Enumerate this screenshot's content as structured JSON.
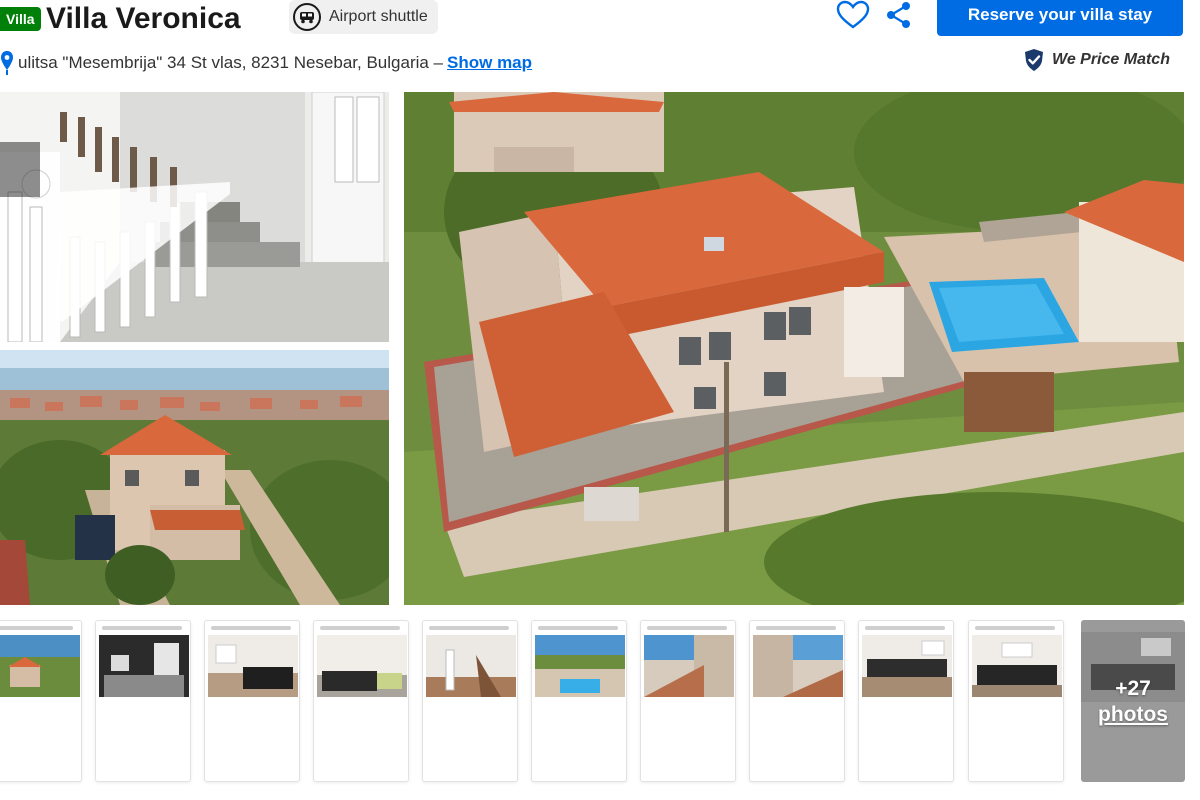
{
  "header": {
    "property_type": "Villa",
    "title": "Villa Veronica",
    "facility_badge": "Airport shuttle",
    "reserve_label": "Reserve your villa stay"
  },
  "location": {
    "address": "ulitsa \"Mesembrija\" 34 St vlas, 8231 Nesebar, Bulgaria –",
    "show_map_label": "Show map"
  },
  "price_match_label": "We Price Match",
  "icons": {
    "favorite": "heart-icon",
    "share": "share-icon",
    "location": "map-pin-icon",
    "shuttle": "shuttle-icon",
    "price_match": "checkmark-shield-icon"
  },
  "gallery": {
    "more_photos_count": "+27",
    "more_photos_word": "photos"
  },
  "colors": {
    "primary_blue": "#006ce4",
    "badge_green": "#008009",
    "roof_orange": "#d9683c",
    "pool_blue": "#2aa7e0"
  }
}
